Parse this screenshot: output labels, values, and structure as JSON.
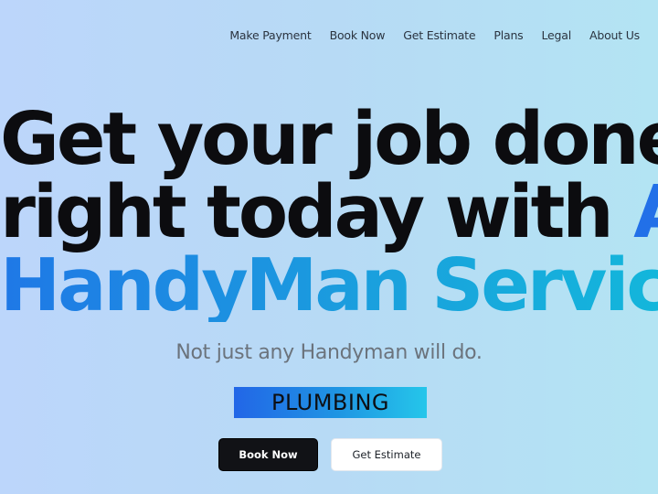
{
  "nav": {
    "items": [
      {
        "label": "Make Payment"
      },
      {
        "label": "Book Now"
      },
      {
        "label": "Get Estimate"
      },
      {
        "label": "Plans"
      },
      {
        "label": "Legal"
      },
      {
        "label": "About Us"
      }
    ]
  },
  "hero": {
    "headline_line1": "Get your job done",
    "headline_line2_prefix": "right today with ",
    "headline_line2_brand": "Adroit",
    "headline_line3": "HandyMan Services",
    "subtitle": "Not just any Handyman will do.",
    "rotating_service": "PLUMBING"
  },
  "actions": {
    "primary_label": "Book Now",
    "secondary_label": "Get Estimate"
  },
  "colors": {
    "brand_blue": "#2270e8",
    "brand_cyan": "#13b6db",
    "primary_button": "#111216",
    "background_start": "#bcd6fb",
    "background_end": "#b3e4f3"
  }
}
